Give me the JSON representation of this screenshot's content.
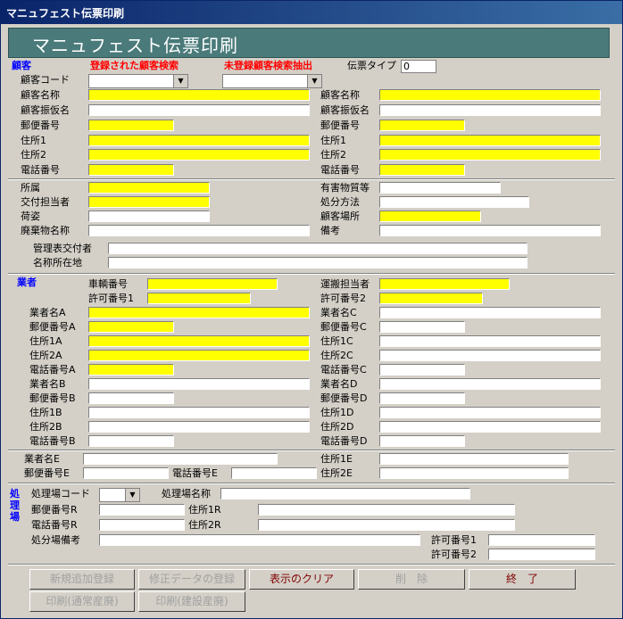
{
  "window": {
    "title": "マニュフェスト伝票印刷"
  },
  "header": {
    "title": "マニュフェスト伝票印刷"
  },
  "customer": {
    "section_label": "顧客",
    "search_registered": "登録された顧客検索",
    "search_unregistered": "未登録顧客検索抽出",
    "slip_type_label": "伝票タイプ",
    "slip_type_value": "0",
    "code_label": "顧客コード",
    "left": {
      "name": "顧客名称",
      "kana": "顧客振仮名",
      "zip": "郵便番号",
      "addr1": "住所1",
      "addr2": "住所2",
      "tel": "電話番号"
    },
    "right": {
      "name": "顧客名称",
      "kana": "顧客振仮名",
      "zip": "郵便番号",
      "addr1": "住所1",
      "addr2": "住所2",
      "tel": "電話番号"
    }
  },
  "misc": {
    "dept": "所属",
    "issuer": "交付担当者",
    "packing": "荷姿",
    "waste": "廃棄物名称",
    "hazard": "有害物質等",
    "disposal": "処分方法",
    "site": "顧客場所",
    "note": "備考",
    "mgr_issuer": "管理表交付者",
    "addr_name": "名称所在地"
  },
  "vendor": {
    "section_label": "業者",
    "vehicle": "車輌番号",
    "driver": "運搬担当者",
    "permit1": "許可番号1",
    "permit2": "許可番号2",
    "left": [
      "業者名A",
      "郵便番号A",
      "住所1A",
      "住所2A",
      "電話番号A",
      "業者名B",
      "郵便番号B",
      "住所1B",
      "住所2B",
      "電話番号B"
    ],
    "right": [
      "業者名C",
      "郵便番号C",
      "住所1C",
      "住所2C",
      "電話番号C",
      "業者名D",
      "郵便番号D",
      "住所1D",
      "住所2D",
      "電話番号D"
    ],
    "nameE": "業者名E",
    "zipE": "郵便番号E",
    "telE": "電話番号E",
    "addr1E": "住所1E",
    "addr2E": "住所2E"
  },
  "plant": {
    "section_label": "処理場",
    "code": "処理場コード",
    "name": "処理場名称",
    "zip": "郵便番号R",
    "tel": "電話番号R",
    "addr1": "住所1R",
    "addr2": "住所2R",
    "note": "処分場備考",
    "permit1": "許可番号1",
    "permit2": "許可番号2"
  },
  "buttons": {
    "add": "新規追加登録",
    "fix": "修正データの登録",
    "clear": "表示のクリア",
    "delete": "削　除",
    "exit": "終　了",
    "print_normal": "印刷(通常産廃)",
    "print_build": "印刷(建設産廃)"
  }
}
